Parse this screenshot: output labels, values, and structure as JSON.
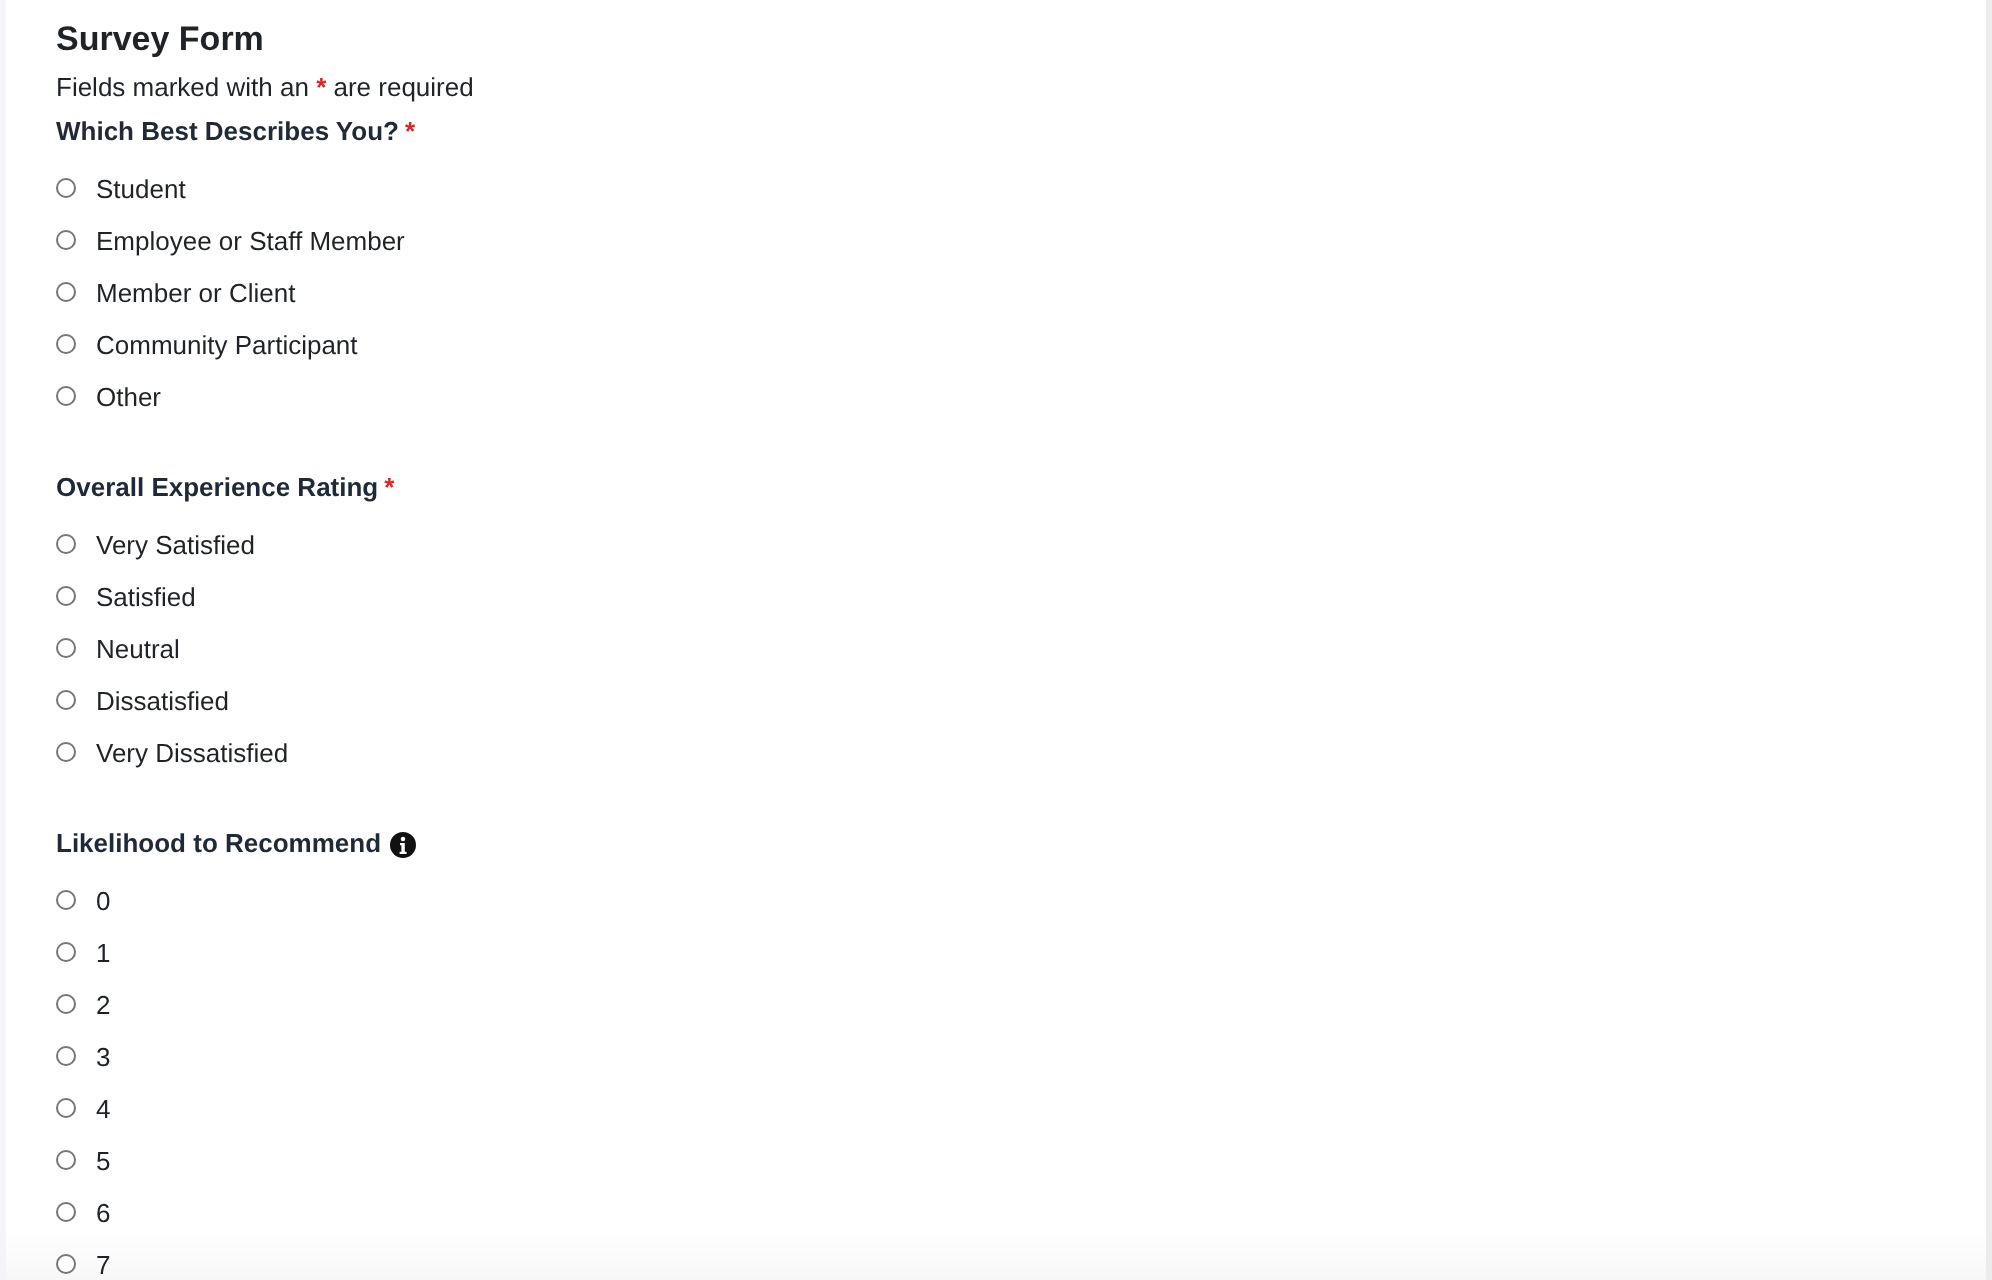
{
  "form": {
    "title": "Survey Form",
    "note": {
      "before": "Fields marked with an",
      "mark": "*",
      "after": "are required"
    },
    "questions": [
      {
        "label": "Which Best Describes You?",
        "required_mark": "*",
        "info": false,
        "options": [
          {
            "label": "Student",
            "selected": false
          },
          {
            "label": "Employee or Staff Member",
            "selected": false
          },
          {
            "label": "Member or Client",
            "selected": false
          },
          {
            "label": "Community Participant",
            "selected": false
          },
          {
            "label": "Other",
            "selected": false
          }
        ]
      },
      {
        "label": "Overall Experience Rating",
        "required_mark": "*",
        "info": false,
        "options": [
          {
            "label": "Very Satisfied",
            "selected": false
          },
          {
            "label": "Satisfied",
            "selected": false
          },
          {
            "label": "Neutral",
            "selected": false
          },
          {
            "label": "Dissatisfied",
            "selected": false
          },
          {
            "label": "Very Dissatisfied",
            "selected": false
          }
        ]
      },
      {
        "label": "Likelihood to Recommend",
        "info": true,
        "options": [
          {
            "label": "0",
            "selected": false
          },
          {
            "label": "1",
            "selected": false
          },
          {
            "label": "2",
            "selected": false
          },
          {
            "label": "3",
            "selected": false
          },
          {
            "label": "4",
            "selected": false
          },
          {
            "label": "5",
            "selected": false
          },
          {
            "label": "6",
            "selected": false
          },
          {
            "label": "7",
            "selected": false
          }
        ]
      }
    ]
  }
}
